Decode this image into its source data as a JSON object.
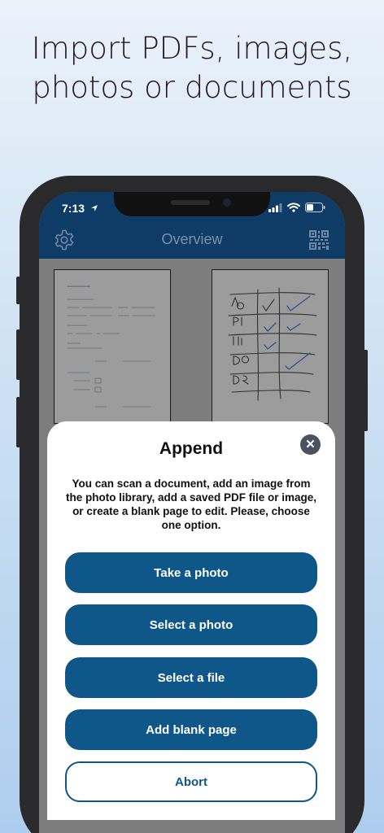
{
  "headline": {
    "line1": "Import PDFs, images,",
    "line2": "photos or documents"
  },
  "status_bar": {
    "time": "7:13"
  },
  "nav": {
    "title": "Overview",
    "settings_icon": "gear-icon",
    "scan_icon": "qr-code-icon"
  },
  "dialog": {
    "title": "Append",
    "description": "You can scan a document, add an image from the photo library, add a saved PDF file or image, or create a blank page to edit. Please, choose one option.",
    "buttons": {
      "take_photo": "Take a photo",
      "select_photo": "Select a photo",
      "select_file": "Select a file",
      "add_blank": "Add blank page",
      "abort": "Abort"
    }
  },
  "colors": {
    "nav_bar": "#0e3c66",
    "primary_button": "#0f5689",
    "overlay": "#7d7d7d"
  }
}
